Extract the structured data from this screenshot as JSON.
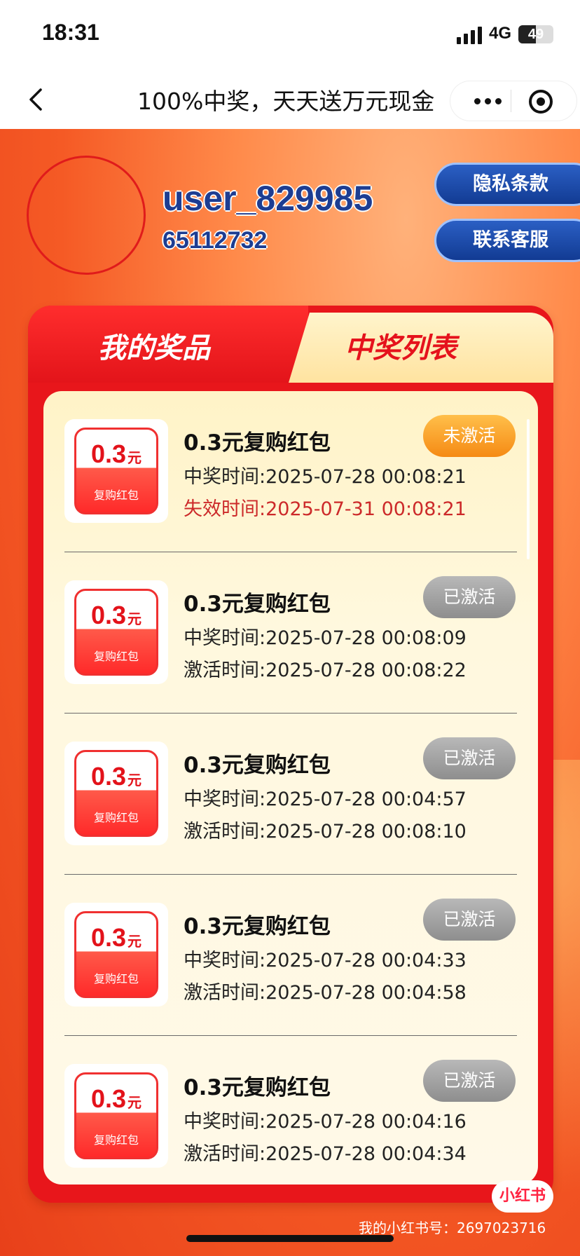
{
  "status_bar": {
    "time": "18:31",
    "network": "4G",
    "battery": "49",
    "battery_level": 0.49
  },
  "nav": {
    "title": "100%中奖，天天送万元现金",
    "icons": [
      "back-icon",
      "more-icon",
      "target-icon"
    ]
  },
  "user": {
    "name": "user_829985",
    "id": "65112732"
  },
  "side_buttons": {
    "privacy": "隐私条款",
    "service": "联系客服"
  },
  "tabs": {
    "mine": "我的奖品",
    "list": "中奖列表"
  },
  "items": [
    {
      "coupon_amount": "0.3",
      "coupon_unit": "元",
      "coupon_label": "复购红包",
      "title": "0.3元复购红包",
      "status": "未激活",
      "win_time": "中奖时间:2025-07-28 00:08:21",
      "sub_time": "失效时间:2025-07-31 00:08:21"
    },
    {
      "coupon_amount": "0.3",
      "coupon_unit": "元",
      "coupon_label": "复购红包",
      "title": "0.3元复购红包",
      "status": "已激活",
      "win_time": "中奖时间:2025-07-28 00:08:09",
      "sub_time": "激活时间:2025-07-28 00:08:22"
    },
    {
      "coupon_amount": "0.3",
      "coupon_unit": "元",
      "coupon_label": "复购红包",
      "title": "0.3元复购红包",
      "status": "已激活",
      "win_time": "中奖时间:2025-07-28 00:04:57",
      "sub_time": "激活时间:2025-07-28 00:08:10"
    },
    {
      "coupon_amount": "0.3",
      "coupon_unit": "元",
      "coupon_label": "复购红包",
      "title": "0.3元复购红包",
      "status": "已激活",
      "win_time": "中奖时间:2025-07-28 00:04:33",
      "sub_time": "激活时间:2025-07-28 00:04:58"
    },
    {
      "coupon_amount": "0.3",
      "coupon_unit": "元",
      "coupon_label": "复购红包",
      "title": "0.3元复购红包",
      "status": "已激活",
      "win_time": "中奖时间:2025-07-28 00:04:16",
      "sub_time": "激活时间:2025-07-28 00:04:34"
    }
  ],
  "watermark": {
    "badge": "小红书",
    "text": "我的小红书号：2697023716"
  },
  "colors": {
    "accent_red": "#e8161b",
    "blue": "#1d3d92",
    "inactive": "#f58a14",
    "active": "#8e8e8e",
    "expire": "#cc2a2a"
  }
}
